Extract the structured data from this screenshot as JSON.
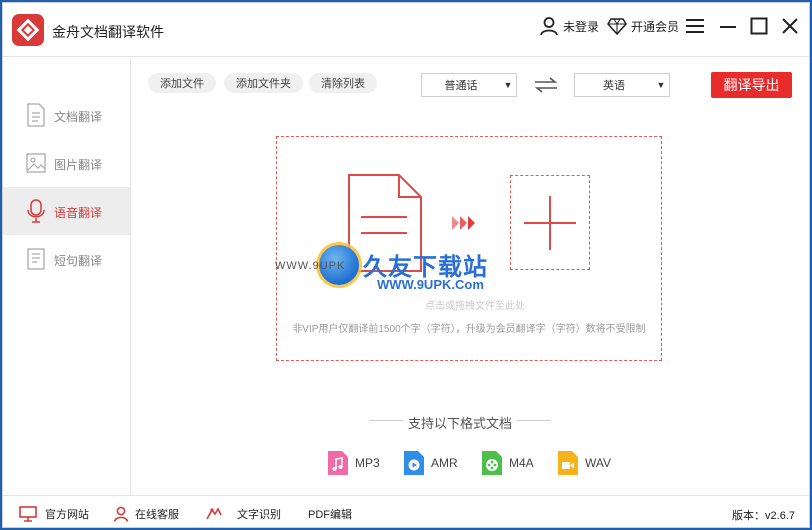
{
  "app": {
    "title": "金舟文档翻译软件"
  },
  "header": {
    "login_label": "未登录",
    "vip_label": "开通会员"
  },
  "sidebar": {
    "items": [
      {
        "label": "文档翻译",
        "icon": "document-icon",
        "active": false
      },
      {
        "label": "图片翻译",
        "icon": "image-icon",
        "active": false
      },
      {
        "label": "语音翻译",
        "icon": "microphone-icon",
        "active": true
      },
      {
        "label": "短句翻译",
        "icon": "text-lines-icon",
        "active": false
      }
    ]
  },
  "toolbar": {
    "add_file": "添加文件",
    "add_folder": "添加文件夹",
    "clear_list": "清除列表",
    "source_lang": "普通话",
    "target_lang": "英语",
    "export": "翻译导出"
  },
  "dropzone": {
    "hint_faint": "点击或拖拽文件至此处",
    "hint": "非VIP用户仅翻译前1500个字（字符），升级为会员翻译字（字符）数将不受限制"
  },
  "watermark": {
    "brand": "久友下载站",
    "url_left": "WWW.9UPK",
    "url": "WWW.9UPK.Com"
  },
  "formats": {
    "title": "支持以下格式文档",
    "items": [
      {
        "label": "MP3",
        "color": "#f06aa8"
      },
      {
        "label": "AMR",
        "color": "#2f8fe8"
      },
      {
        "label": "M4A",
        "color": "#4cbf4c"
      },
      {
        "label": "WAV",
        "color": "#f5b21b"
      }
    ]
  },
  "footer": {
    "website": "官方网站",
    "support": "在线客服",
    "ocr": "文字识别",
    "pdf": "PDF编辑",
    "version": "版本：v2.6.7"
  },
  "colors": {
    "accent": "#e82b2b",
    "border_dashed": "#e05a5a"
  }
}
